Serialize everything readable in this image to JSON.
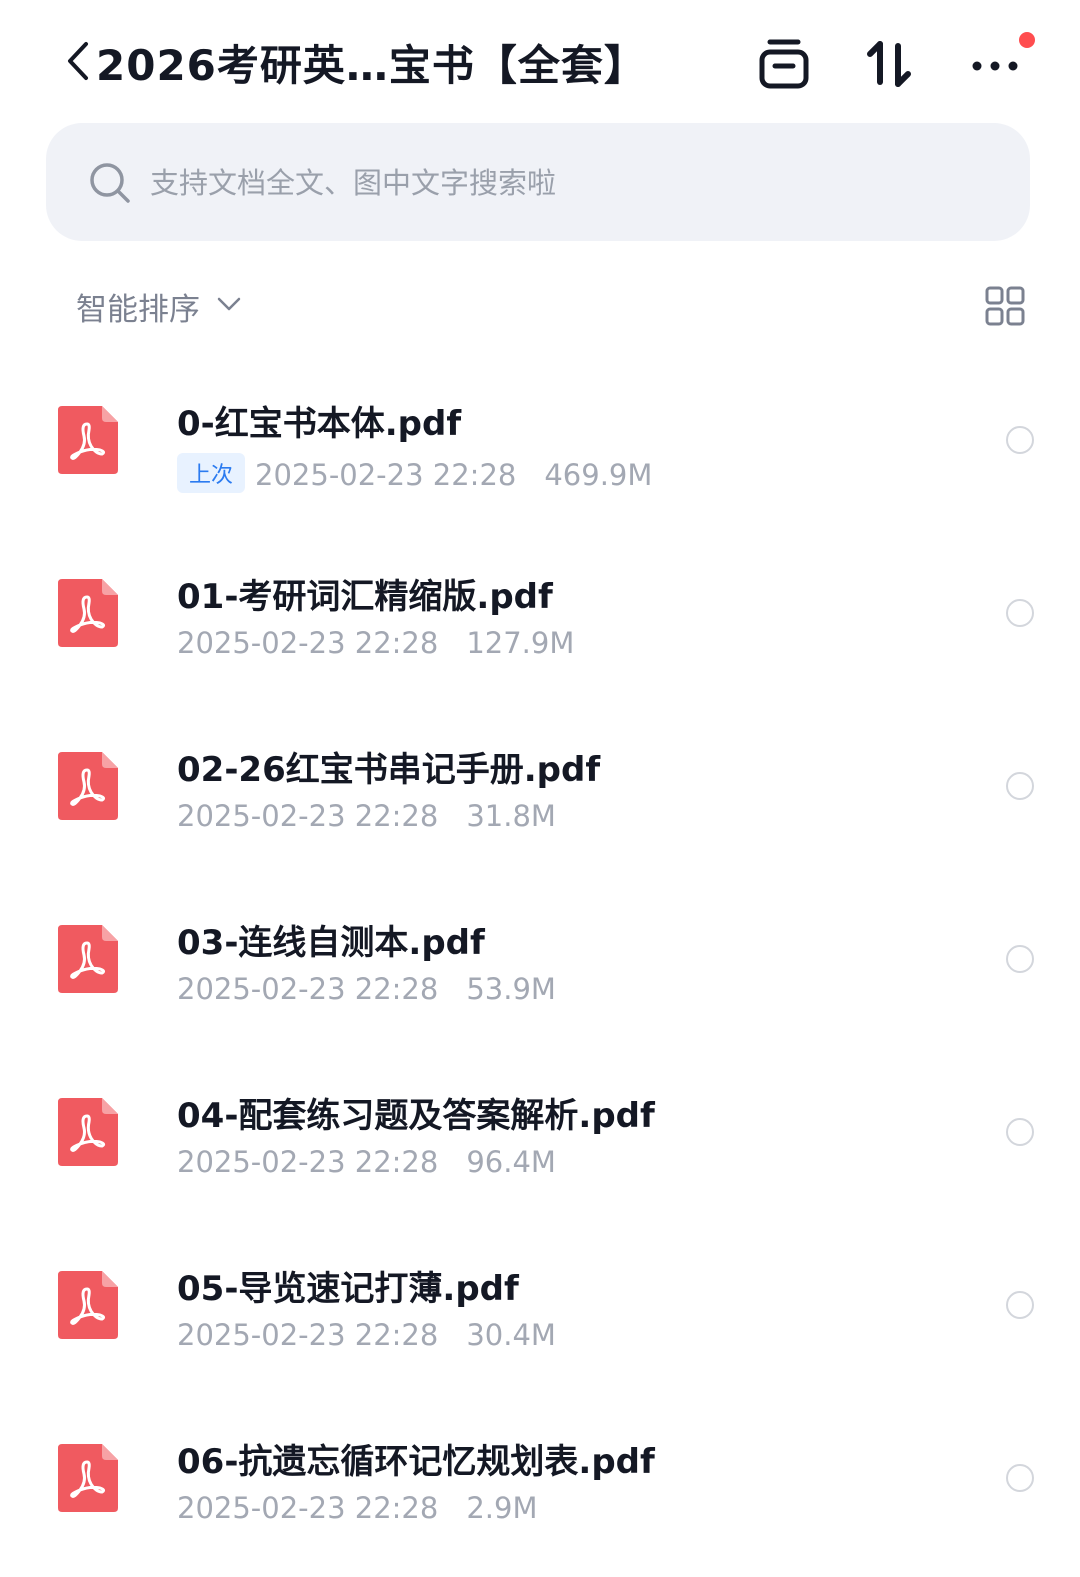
{
  "header": {
    "title": "2026考研英…宝书【全套】",
    "icons": [
      "back-icon",
      "archive-icon",
      "sort-icon",
      "more-icon"
    ]
  },
  "search": {
    "placeholder": "支持文档全文、图中文字搜索啦"
  },
  "sortbar": {
    "sort_label": "智能排序",
    "view_icon": "grid-view-icon"
  },
  "files": [
    {
      "name": "0-红宝书本体.pdf",
      "badge": "上次",
      "date": "2025-02-23 22:28",
      "size": "469.9M"
    },
    {
      "name": "01-考研词汇精缩版.pdf",
      "badge": "",
      "date": "2025-02-23 22:28",
      "size": "127.9M"
    },
    {
      "name": "02-26红宝书串记手册.pdf",
      "badge": "",
      "date": "2025-02-23 22:28",
      "size": "31.8M"
    },
    {
      "name": "03-连线自测本.pdf",
      "badge": "",
      "date": "2025-02-23 22:28",
      "size": "53.9M"
    },
    {
      "name": "04-配套练习题及答案解析.pdf",
      "badge": "",
      "date": "2025-02-23 22:28",
      "size": "96.4M"
    },
    {
      "name": "05-导览速记打薄.pdf",
      "badge": "",
      "date": "2025-02-23 22:28",
      "size": "30.4M"
    },
    {
      "name": "06-抗遗忘循环记忆规划表.pdf",
      "badge": "",
      "date": "2025-02-23 22:28",
      "size": "2.9M"
    }
  ],
  "colors": {
    "pdf_icon": "#f05a60",
    "badge_bg": "#e8f2ff",
    "badge_text": "#2b7bf0",
    "notification_dot": "#ff4d4f"
  }
}
